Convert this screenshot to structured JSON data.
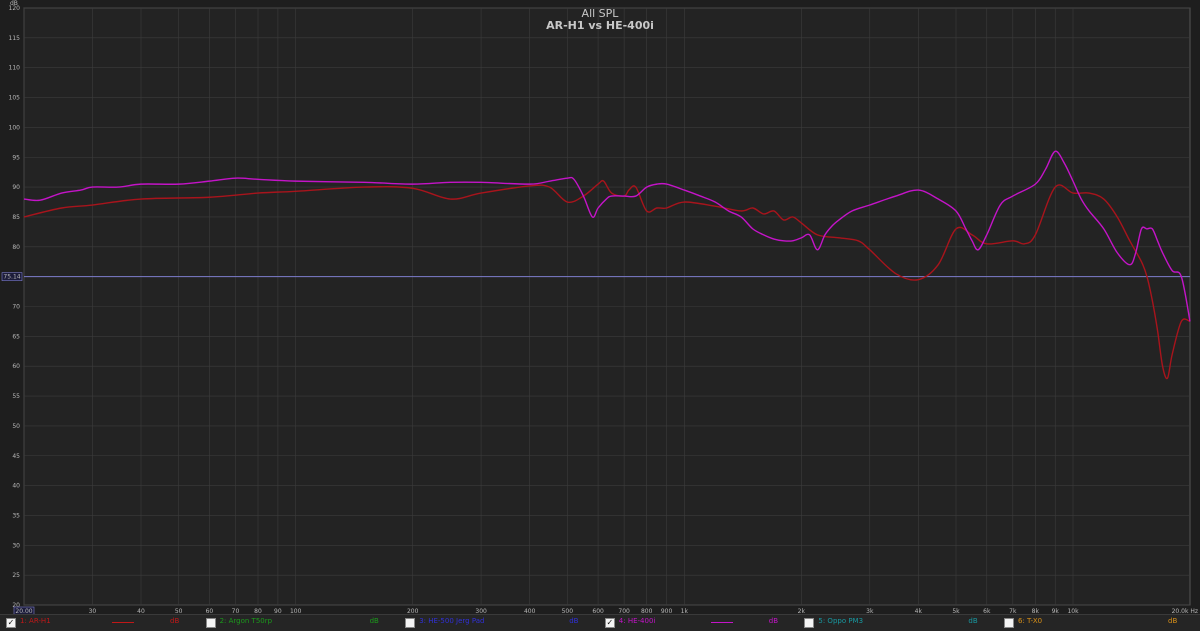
{
  "chart_data": {
    "type": "line",
    "title": "All SPL",
    "subtitle": "AR-H1 vs HE-400i",
    "ylabel": "dB",
    "xlabel": "Hz",
    "x_scale": "log",
    "xlim": [
      20,
      20000
    ],
    "ylim": [
      20,
      120
    ],
    "y_ticks": [
      20,
      25,
      30,
      35,
      40,
      45,
      50,
      55,
      60,
      65,
      70,
      75,
      80,
      85,
      90,
      95,
      100,
      105,
      110,
      115,
      120
    ],
    "x_tick_labels": [
      {
        "f": 20,
        "t": "20.00"
      },
      {
        "f": 30,
        "t": "30"
      },
      {
        "f": 40,
        "t": "40"
      },
      {
        "f": 50,
        "t": "50"
      },
      {
        "f": 60,
        "t": "60"
      },
      {
        "f": 70,
        "t": "70"
      },
      {
        "f": 80,
        "t": "80"
      },
      {
        "f": 90,
        "t": "90"
      },
      {
        "f": 100,
        "t": "100"
      },
      {
        "f": 200,
        "t": "200"
      },
      {
        "f": 300,
        "t": "300"
      },
      {
        "f": 400,
        "t": "400"
      },
      {
        "f": 500,
        "t": "500"
      },
      {
        "f": 600,
        "t": "600"
      },
      {
        "f": 700,
        "t": "700"
      },
      {
        "f": 800,
        "t": "800"
      },
      {
        "f": 900,
        "t": "900"
      },
      {
        "f": 1000,
        "t": "1k"
      },
      {
        "f": 2000,
        "t": "2k"
      },
      {
        "f": 3000,
        "t": "3k"
      },
      {
        "f": 4000,
        "t": "4k"
      },
      {
        "f": 5000,
        "t": "5k"
      },
      {
        "f": 6000,
        "t": "6k"
      },
      {
        "f": 7000,
        "t": "7k"
      },
      {
        "f": 8000,
        "t": "8k"
      },
      {
        "f": 9000,
        "t": "9k"
      },
      {
        "f": 10000,
        "t": "10k"
      },
      {
        "f": 20000,
        "t": "20.0k Hz"
      }
    ],
    "reference_line": {
      "value": 75,
      "label": "75.14",
      "color": "#7d7dcc"
    },
    "grid": true,
    "series": [
      {
        "name": "1: AR-H1",
        "color": "#a8141c",
        "x": [
          20,
          25,
          30,
          40,
          60,
          80,
          100,
          150,
          200,
          250,
          300,
          400,
          450,
          500,
          550,
          600,
          620,
          650,
          700,
          720,
          750,
          800,
          850,
          900,
          1000,
          1200,
          1400,
          1500,
          1600,
          1700,
          1800,
          1900,
          2000,
          2200,
          2500,
          2800,
          3000,
          3500,
          4000,
          4500,
          5000,
          5500,
          6000,
          7000,
          7500,
          8000,
          9000,
          10000,
          11000,
          12000,
          13000,
          14000,
          15000,
          15500,
          16000,
          16500,
          17000,
          17500,
          18000,
          19000,
          20000
        ],
        "y": [
          85,
          86.5,
          87,
          88,
          88.3,
          89,
          89.3,
          90,
          89.8,
          88,
          89,
          90.2,
          90,
          87.5,
          88.5,
          90.5,
          91,
          89,
          88.5,
          89.5,
          90,
          86,
          86.5,
          86.5,
          87.5,
          86.8,
          86,
          86.5,
          85.5,
          86,
          84.5,
          85,
          84,
          82,
          81.5,
          81,
          79.5,
          75.5,
          74.5,
          77,
          83,
          82,
          80.5,
          81,
          80.5,
          82,
          90,
          89,
          89,
          88,
          85,
          81,
          77.5,
          75,
          71,
          66,
          60,
          58,
          62,
          67.5,
          67.5
        ]
      },
      {
        "name": "4: HE-400i",
        "color": "#c414c8",
        "x": [
          20,
          22,
          25,
          28,
          30,
          35,
          40,
          50,
          60,
          70,
          80,
          100,
          150,
          200,
          250,
          300,
          400,
          450,
          500,
          520,
          550,
          580,
          600,
          630,
          650,
          700,
          750,
          800,
          850,
          900,
          1000,
          1100,
          1200,
          1300,
          1400,
          1500,
          1600,
          1700,
          1800,
          1900,
          2000,
          2100,
          2200,
          2300,
          2400,
          2500,
          2700,
          3000,
          3500,
          4000,
          4500,
          5000,
          5300,
          5500,
          5700,
          6000,
          6500,
          7000,
          8000,
          8500,
          9000,
          9500,
          10000,
          10500,
          11000,
          12000,
          13000,
          14000,
          14500,
          15000,
          15500,
          16000,
          16500,
          17000,
          18000,
          19000,
          20000
        ],
        "y": [
          88,
          87.8,
          89,
          89.5,
          90,
          90,
          90.5,
          90.5,
          91,
          91.5,
          91.3,
          91,
          90.8,
          90.5,
          90.8,
          90.8,
          90.5,
          91,
          91.5,
          91.3,
          88.5,
          85,
          86.5,
          88,
          88.5,
          88.5,
          88.5,
          90,
          90.5,
          90.5,
          89.5,
          88.5,
          87.5,
          86,
          85,
          83,
          82,
          81.3,
          81,
          81,
          81.5,
          82,
          79.5,
          82,
          83.5,
          84.5,
          86,
          87,
          88.5,
          89.5,
          88,
          86,
          83,
          81,
          79.5,
          82,
          87,
          88.5,
          90.5,
          93,
          96,
          94,
          91,
          88,
          86,
          83,
          79,
          77,
          79,
          83,
          83,
          83,
          81,
          79,
          76,
          75,
          67.5
        ]
      }
    ]
  },
  "legend": {
    "items": [
      {
        "checked": true,
        "label": "1: AR-H1",
        "unit": "dB",
        "color": "#c01818",
        "swatch": true
      },
      {
        "checked": false,
        "label": "2: Argon T50rp",
        "unit": "dB",
        "color": "#1c9a1c",
        "swatch": false
      },
      {
        "checked": false,
        "label": "3: HE-500 Jerg Pad",
        "unit": "dB",
        "color": "#3030d8",
        "swatch": false
      },
      {
        "checked": true,
        "label": "4: HE-400i",
        "unit": "dB",
        "color": "#c414c8",
        "swatch": true
      },
      {
        "checked": false,
        "label": "5: Oppo PM3",
        "unit": "dB",
        "color": "#1898a0",
        "swatch": false
      },
      {
        "checked": false,
        "label": "6: T-X0",
        "unit": "dB",
        "color": "#d89018",
        "swatch": false
      }
    ]
  }
}
